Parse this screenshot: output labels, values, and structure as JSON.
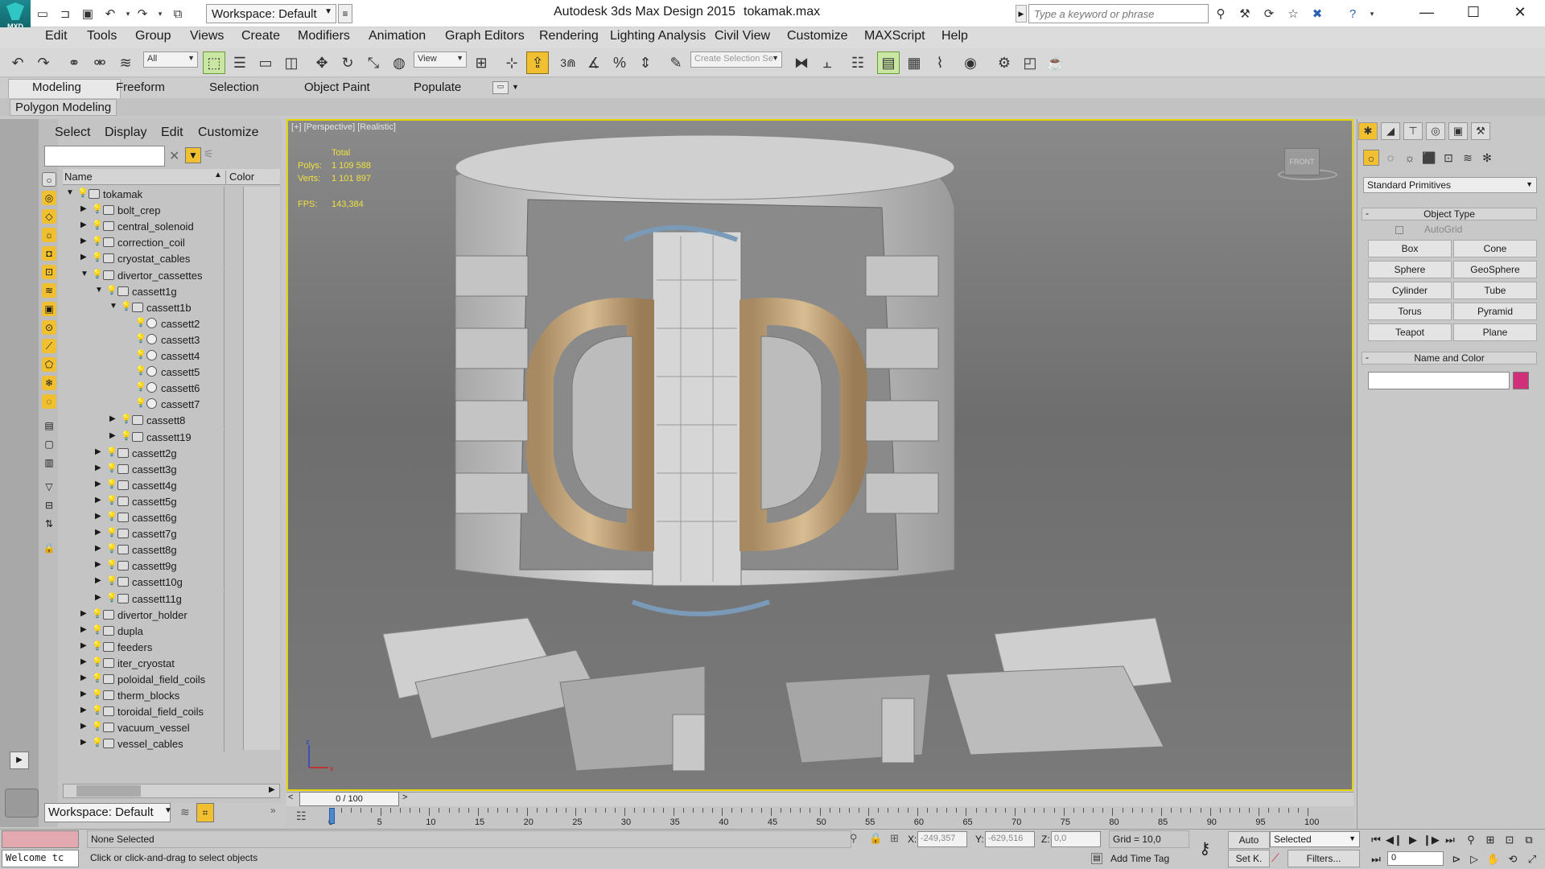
{
  "window": {
    "app_title": "Autodesk 3ds Max Design 2015",
    "file_title": "tokamak.max",
    "logo_text": "MXD",
    "workspace": "Workspace: Default",
    "search_placeholder": "Type a keyword or phrase"
  },
  "menu": [
    "Edit",
    "Tools",
    "Group",
    "Views",
    "Create",
    "Modifiers",
    "Animation",
    "Graph Editors",
    "Rendering",
    "Lighting Analysis",
    "Civil View",
    "Customize",
    "MAXScript",
    "Help"
  ],
  "toolbar": {
    "selection_filter": "All",
    "ref_coord": "View",
    "selection_set_placeholder": "Create Selection Se",
    "snap_label": "3"
  },
  "ribbon": {
    "tabs": [
      "Modeling",
      "Freeform",
      "Selection",
      "Object Paint",
      "Populate"
    ],
    "active_tab": "Modeling",
    "panel": "Polygon Modeling"
  },
  "explorer": {
    "menu": [
      "Select",
      "Display",
      "Edit",
      "Customize"
    ],
    "col_name": "Name",
    "col_color": "Color",
    "workspace": "Workspace: Default",
    "rows": [
      {
        "label": "tokamak",
        "depth": 0,
        "toggle": "open",
        "icon": "group",
        "bulb": true,
        "color": "#dcdcdc"
      },
      {
        "label": "bolt_crep",
        "depth": 1,
        "toggle": "closed",
        "icon": "group",
        "bulb": true,
        "color": "#dcdcdc"
      },
      {
        "label": "central_solenoid",
        "depth": 1,
        "toggle": "closed",
        "icon": "group",
        "bulb": true,
        "color": "#dcdcdc"
      },
      {
        "label": "correction_coil",
        "depth": 1,
        "toggle": "closed",
        "icon": "group",
        "bulb": true,
        "color": "#dcdcdc"
      },
      {
        "label": "cryostat_cables",
        "depth": 1,
        "toggle": "closed",
        "icon": "group",
        "bulb": true,
        "color": "#dcdcdc"
      },
      {
        "label": "divertor_cassettes",
        "depth": 1,
        "toggle": "open",
        "icon": "group",
        "bulb": true,
        "color": "#dcdcdc"
      },
      {
        "label": "cassett1g",
        "depth": 2,
        "toggle": "open",
        "icon": "group",
        "bulb": true,
        "color": "#dcdcdc"
      },
      {
        "label": "cassett1b",
        "depth": 3,
        "toggle": "open",
        "icon": "group",
        "bulb": true,
        "color": "#dcdcdc"
      },
      {
        "label": "cassett2",
        "depth": 4,
        "toggle": "none",
        "icon": "object",
        "bulb": true,
        "color": "#dcdcdc"
      },
      {
        "label": "cassett3",
        "depth": 4,
        "toggle": "none",
        "icon": "object",
        "bulb": true,
        "color": "#dcdcdc"
      },
      {
        "label": "cassett4",
        "depth": 4,
        "toggle": "none",
        "icon": "object",
        "bulb": true,
        "color": "#dcdcdc"
      },
      {
        "label": "cassett5",
        "depth": 4,
        "toggle": "none",
        "icon": "object",
        "bulb": true,
        "color": "#dcdcdc"
      },
      {
        "label": "cassett6",
        "depth": 4,
        "toggle": "none",
        "icon": "object",
        "bulb": true,
        "color": "#dcdcdc"
      },
      {
        "label": "cassett7",
        "depth": 4,
        "toggle": "none",
        "icon": "object",
        "bulb": true,
        "color": "#dcdcdc"
      },
      {
        "label": "cassett8",
        "depth": 3,
        "toggle": "closed",
        "icon": "group",
        "bulb": true,
        "color": "#dcdcdc"
      },
      {
        "label": "cassett19",
        "depth": 3,
        "toggle": "closed",
        "icon": "group",
        "bulb": true,
        "color": "#dcdcdc"
      },
      {
        "label": "cassett2g",
        "depth": 2,
        "toggle": "closed",
        "icon": "group",
        "bulb": true,
        "color": "#dcdcdc"
      },
      {
        "label": "cassett3g",
        "depth": 2,
        "toggle": "closed",
        "icon": "group",
        "bulb": true,
        "color": "#dcdcdc"
      },
      {
        "label": "cassett4g",
        "depth": 2,
        "toggle": "closed",
        "icon": "group",
        "bulb": true,
        "color": "#dcdcdc"
      },
      {
        "label": "cassett5g",
        "depth": 2,
        "toggle": "closed",
        "icon": "group",
        "bulb": true,
        "color": "#dcdcdc"
      },
      {
        "label": "cassett6g",
        "depth": 2,
        "toggle": "closed",
        "icon": "group",
        "bulb": true,
        "color": "#dcdcdc"
      },
      {
        "label": "cassett7g",
        "depth": 2,
        "toggle": "closed",
        "icon": "group",
        "bulb": true,
        "color": "#dcdcdc"
      },
      {
        "label": "cassett8g",
        "depth": 2,
        "toggle": "closed",
        "icon": "group",
        "bulb": true,
        "color": "#dcdcdc"
      },
      {
        "label": "cassett9g",
        "depth": 2,
        "toggle": "closed",
        "icon": "group",
        "bulb": true,
        "color": "#dcdcdc"
      },
      {
        "label": "cassett10g",
        "depth": 2,
        "toggle": "closed",
        "icon": "group",
        "bulb": true,
        "color": "#dcdcdc"
      },
      {
        "label": "cassett11g",
        "depth": 2,
        "toggle": "closed",
        "icon": "group",
        "bulb": true,
        "color": "#dcdcdc"
      },
      {
        "label": "divertor_holder",
        "depth": 1,
        "toggle": "closed",
        "icon": "group",
        "bulb": true,
        "color": "#dcdcdc"
      },
      {
        "label": "dupla",
        "depth": 1,
        "toggle": "closed",
        "icon": "group",
        "bulb": true,
        "color": "#dcdcdc"
      },
      {
        "label": "feeders",
        "depth": 1,
        "toggle": "closed",
        "icon": "group",
        "bulb": true,
        "color": "#bdbdbd"
      },
      {
        "label": "iter_cryostat",
        "depth": 1,
        "toggle": "closed",
        "icon": "group",
        "bulb": true,
        "color": "#dcdcdc"
      },
      {
        "label": "poloidal_field_coils",
        "depth": 1,
        "toggle": "closed",
        "icon": "group",
        "bulb": true,
        "color": "#dcdcdc"
      },
      {
        "label": "therm_blocks",
        "depth": 1,
        "toggle": "closed",
        "icon": "group",
        "bulb": true,
        "color": "#dcdcdc"
      },
      {
        "label": "toroidal_field_coils",
        "depth": 1,
        "toggle": "closed",
        "icon": "group",
        "bulb": true,
        "color": "#e6d2a8"
      },
      {
        "label": "vacuum_vessel",
        "depth": 1,
        "toggle": "closed",
        "icon": "group",
        "bulb": true,
        "color": "#c8ae88"
      },
      {
        "label": "vessel_cables",
        "depth": 1,
        "toggle": "closed",
        "icon": "group",
        "bulb": true,
        "color": "#dcdcdc"
      }
    ]
  },
  "viewport": {
    "label": "[+] [Perspective] [Realistic]",
    "stats_header": "Total",
    "polys_label": "Polys:",
    "polys_value": "1 109 588",
    "verts_label": "Verts:",
    "verts_value": "1 101 897",
    "fps_label": "FPS:",
    "fps_value": "143,384",
    "viewcube_text": "FRONT"
  },
  "command_panel": {
    "category": "Standard Primitives",
    "object_type_title": "Object Type",
    "autogrid": "AutoGrid",
    "buttons": [
      "Box",
      "Cone",
      "Sphere",
      "GeoSphere",
      "Cylinder",
      "Tube",
      "Torus",
      "Pyramid",
      "Teapot",
      "Plane"
    ],
    "name_color_title": "Name and Color",
    "object_color": "#d0307a"
  },
  "timeline": {
    "slider_text": "0 / 100",
    "ticks": [
      "0",
      "5",
      "10",
      "15",
      "20",
      "25",
      "30",
      "35",
      "40",
      "45",
      "50",
      "55",
      "60",
      "65",
      "70",
      "75",
      "80",
      "85",
      "90",
      "95",
      "100"
    ]
  },
  "status": {
    "listener_text": "Welcome tc",
    "selection": "None Selected",
    "prompt": "Click or click-and-drag to select objects",
    "x_label": "X:",
    "x_value": "-249,357",
    "y_label": "Y:",
    "y_value": "-629,516",
    "z_label": "Z:",
    "z_value": "0,0",
    "grid": "Grid = 10,0",
    "add_time_tag": "Add Time Tag",
    "auto_key": "Auto",
    "set_key": "Set K.",
    "key_filter": "Selected",
    "filters": "Filters...",
    "frame": "0"
  }
}
